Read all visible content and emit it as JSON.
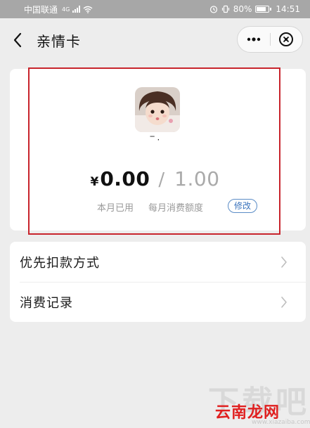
{
  "status_bar": {
    "carrier": "中国联通",
    "network": "4G",
    "alarm_icon": "alarm-icon",
    "vibrate_icon": "vibrate-icon",
    "battery_percent": "80%",
    "battery_level": 0.8,
    "time": "14:51"
  },
  "nav": {
    "back_icon": "chevron-left-icon",
    "title": "亲情卡",
    "more_icon": "more-dots-icon",
    "close_icon": "close-circle-icon"
  },
  "card": {
    "name": "‾ ·",
    "currency_symbol": "¥",
    "used_amount": "0.00",
    "separator": "/",
    "monthly_quota": "1.00",
    "used_label": "本月已用",
    "quota_label": "每月消费额度",
    "modify_label": "修改"
  },
  "menu": {
    "items": [
      {
        "label": "优先扣款方式",
        "icon": "chevron-right-icon"
      },
      {
        "label": "消费记录",
        "icon": "chevron-right-icon"
      }
    ]
  },
  "watermark": {
    "big": "下载吧",
    "logo": "云南龙网",
    "url": "www.xiazaiba.com"
  },
  "colors": {
    "background": "#ededed",
    "status_bar": "#a7a7a7",
    "highlight": "#c8242c",
    "link_blue": "#3b74bd",
    "muted": "#999999"
  }
}
